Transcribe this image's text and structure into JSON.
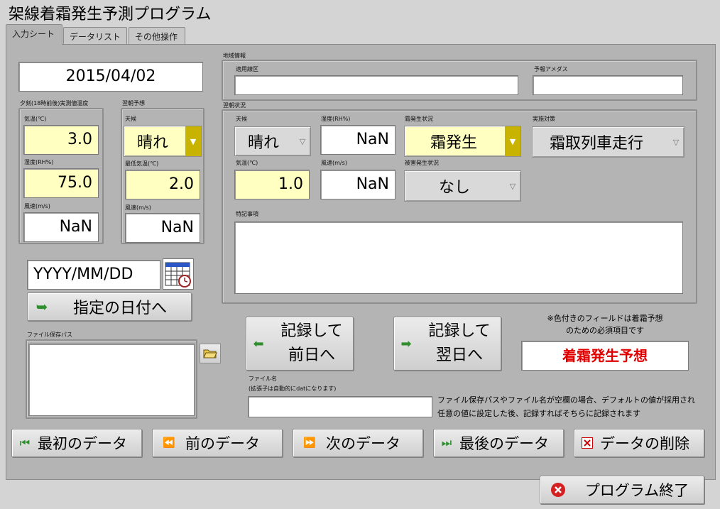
{
  "app": {
    "title": "架線着霜発生予測プログラム"
  },
  "tabs": [
    "入力シート",
    "データリスト",
    "その他操作"
  ],
  "date_display": "2015/04/02",
  "evening": {
    "section_label": "夕刻(18時前後)実測値温度",
    "temp_label": "気温(℃)",
    "temp_value": "3.0",
    "humidity_label": "湿度(RH%)",
    "humidity_value": "75.0",
    "wind_label": "風速(m/s)",
    "wind_value": "NaN"
  },
  "forecast": {
    "section_label": "翌朝予想",
    "weather_label": "天候",
    "weather_value": "晴れ",
    "min_temp_label": "最低気温(℃)",
    "min_temp_value": "2.0",
    "wind_label": "風速(m/s)",
    "wind_value": "NaN"
  },
  "date_input": {
    "placeholder": "YYYY/MM/DD"
  },
  "goto_date_button": "指定の日付へ",
  "file_path": {
    "label": "ファイル保存パス",
    "value": ""
  },
  "region": {
    "section_label": "地域情報",
    "line_label": "適用線区",
    "line_value": "",
    "amedas_label": "予報アメダス",
    "amedas_value": ""
  },
  "morning": {
    "section_label": "翌朝状況",
    "weather_label": "天候",
    "weather_value": "晴れ",
    "humidity_label": "湿度(RH%)",
    "humidity_value": "NaN",
    "frost_label": "霜発生状況",
    "frost_value": "霜発生",
    "measure_label": "実施対策",
    "measure_value": "霜取列車走行",
    "temp_label": "気温(℃)",
    "temp_value": "1.0",
    "wind_label": "風速(m/s)",
    "wind_value": "NaN",
    "damage_label": "被害発生状況",
    "damage_value": "なし",
    "notes_label": "特記事項",
    "notes_value": ""
  },
  "record_prev_button": {
    "line1": "記録して",
    "line2": "前日へ"
  },
  "record_next_button": {
    "line1": "記録して",
    "line2": "翌日へ"
  },
  "required_note": {
    "line1": "※色付きのフィールドは着霜予想",
    "line2": "のための必須項目です"
  },
  "predict_button": "着霜発生予想",
  "file_name": {
    "label1": "ファイル名",
    "label2": "(拡張子は自動的にdatになります)",
    "value": ""
  },
  "info_text": {
    "line1": "ファイル保存パスやファイル名が空欄の場合、デフォルトの値が採用され",
    "line2": "任意の値に設定した後、記録すればそちらに記録されます"
  },
  "nav": {
    "first": "最初のデータ",
    "prev": "前のデータ",
    "next": "次のデータ",
    "last": "最後のデータ",
    "delete": "データの削除"
  },
  "exit_button": "プログラム終了",
  "colors": {
    "required_bg": "#ffffc2",
    "panel_bg": "#b4b4b4",
    "predict_text": "#e00000",
    "gold_arrow": "#c8b400"
  }
}
